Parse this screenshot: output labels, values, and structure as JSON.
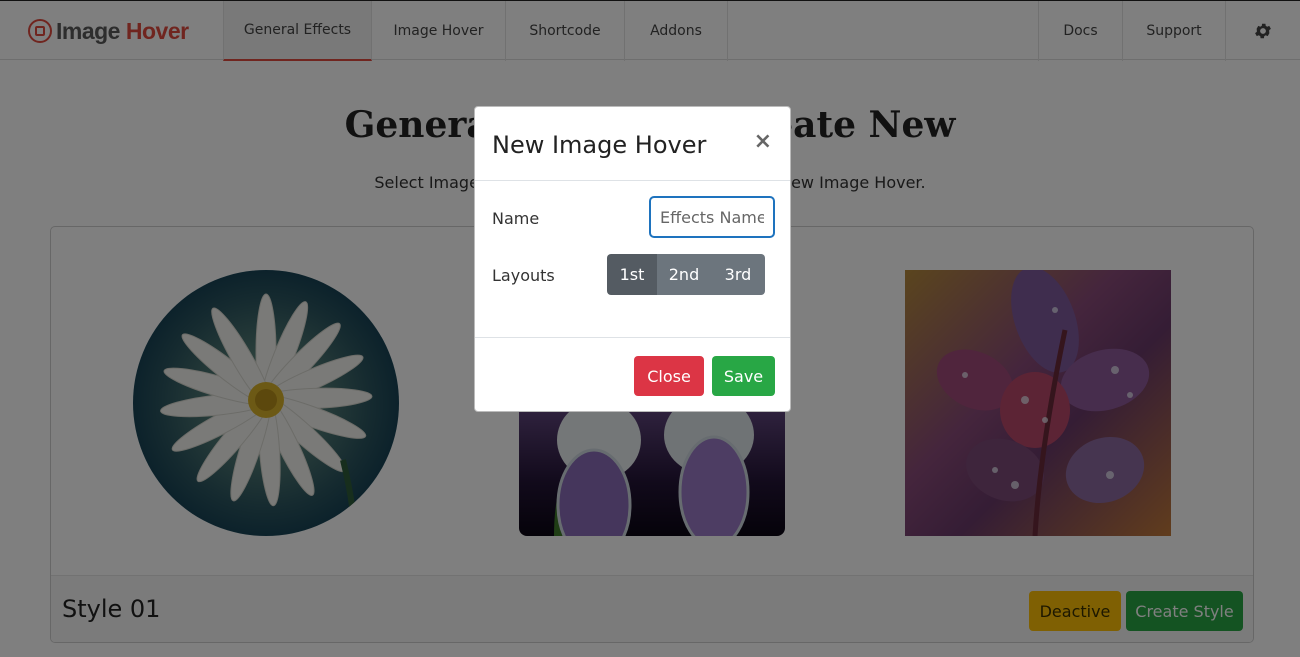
{
  "brand": {
    "part1": "Image",
    "part2": "Hover"
  },
  "nav": {
    "tabs": [
      "General Effects",
      "Image Hover",
      "Shortcode",
      "Addons"
    ],
    "right": [
      "Docs",
      "Support"
    ],
    "settings_icon": "gear-icon"
  },
  "page": {
    "title": "General Effects or Create New",
    "subtitle": "Select Image Hover Effects from the list, or create new Image Hover."
  },
  "card": {
    "style_name": "Style 01",
    "deactive_label": "Deactive",
    "create_label": "Create Style"
  },
  "modal": {
    "title": "New Image Hover",
    "close_icon": "×",
    "name_label": "Name",
    "name_placeholder": "Effects Name",
    "layouts_label": "Layouts",
    "layouts": [
      "1st",
      "2nd",
      "3rd"
    ],
    "selected_layout": "1st",
    "close_label": "Close",
    "save_label": "Save"
  },
  "colors": {
    "accent": "#e04a3f",
    "danger": "#dc3545",
    "success": "#28a745",
    "warning": "#ffc107",
    "input_focus": "#1e73be"
  }
}
